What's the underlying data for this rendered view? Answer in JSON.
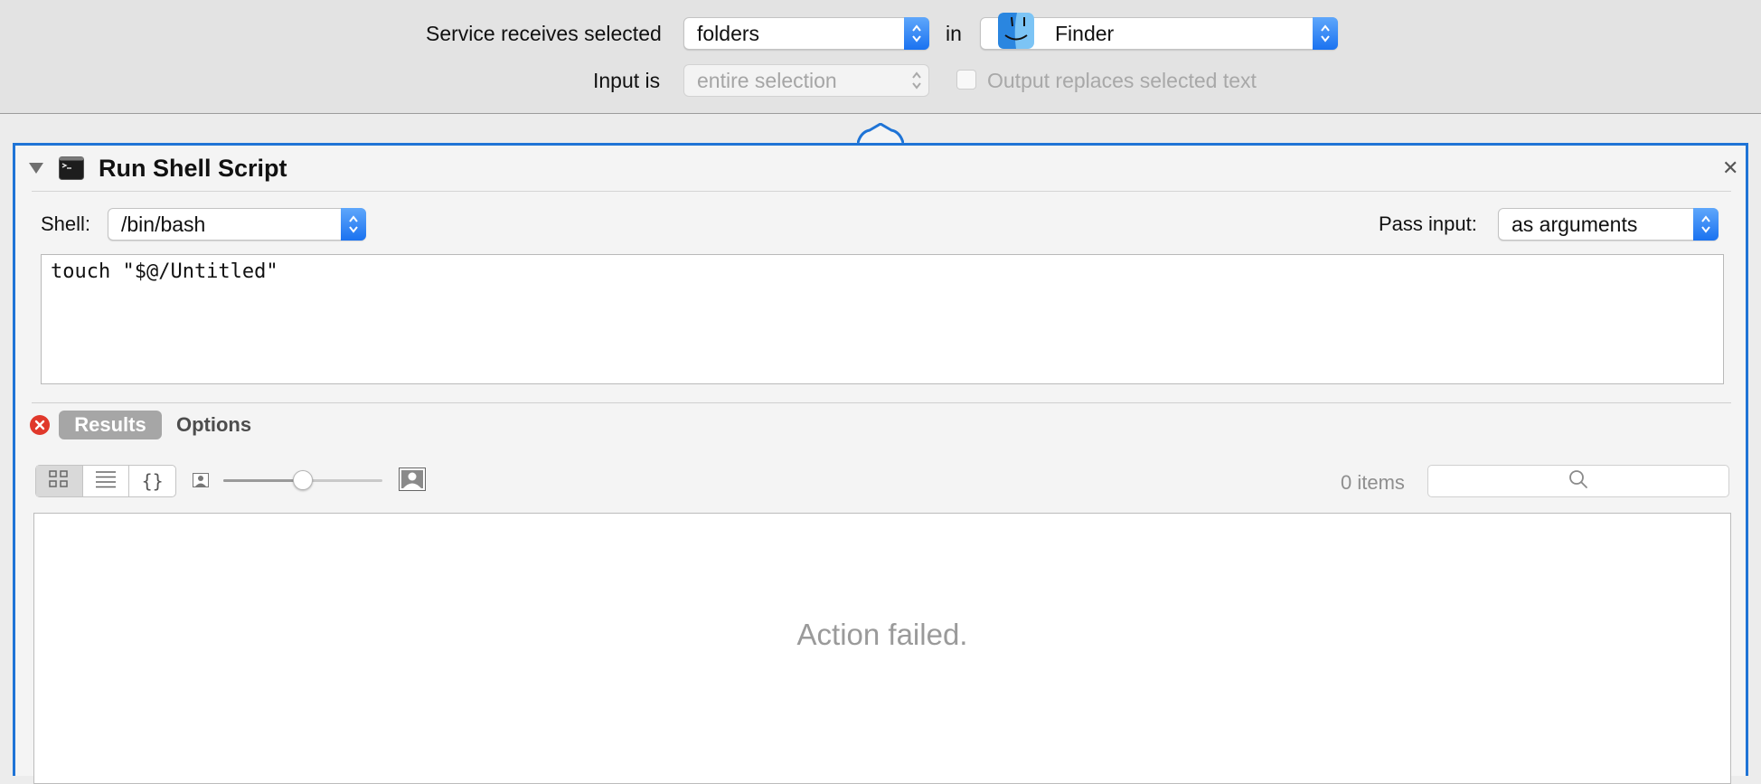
{
  "service_bar": {
    "receives_label": "Service receives selected",
    "receives_value": "folders",
    "in_label": "in",
    "app_value": "Finder",
    "app_icon": "finder-icon",
    "input_label": "Input is",
    "input_value": "entire selection",
    "output_checkbox_label": "Output replaces selected text",
    "output_checked": false
  },
  "action": {
    "title": "Run Shell Script",
    "icon": "terminal-icon",
    "close_glyph": "✕",
    "shell_label": "Shell:",
    "shell_value": "/bin/bash",
    "pass_input_label": "Pass input:",
    "pass_input_value": "as arguments",
    "script": "touch \"$@/Untitled\""
  },
  "results": {
    "status_icon": "error-icon",
    "tabs": [
      {
        "label": "Results",
        "selected": true
      },
      {
        "label": "Options",
        "selected": false
      }
    ],
    "view_modes": [
      {
        "name": "icon-view",
        "selected": true
      },
      {
        "name": "list-view",
        "selected": false
      },
      {
        "name": "code-view",
        "label": "{}",
        "selected": false
      }
    ],
    "icon_size_level": 0.5,
    "item_count": "0 items",
    "search_placeholder": "",
    "message": "Action failed."
  },
  "colors": {
    "accent": "#1f74d6",
    "error": "#e0382b",
    "popup_blue": "#1a72f0"
  }
}
